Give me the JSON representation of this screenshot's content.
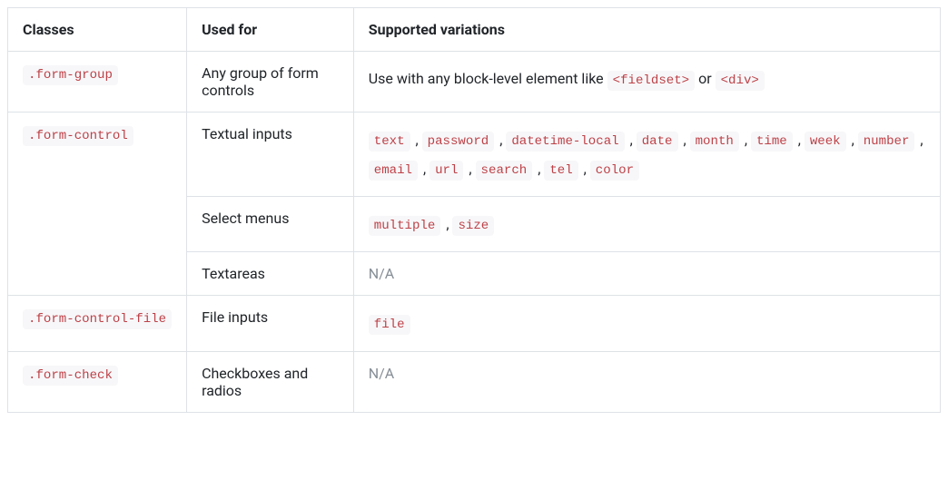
{
  "headers": {
    "col0": "Classes",
    "col1": "Used for",
    "col2": "Supported variations"
  },
  "rows": {
    "r0": {
      "class_code": ".form-group",
      "used_for": "Any group of form controls",
      "variations_prefix": "Use with any block-level element like ",
      "variations_codes": {
        "c0": "<fieldset>",
        "c1": "<div>"
      },
      "variations_sep": " or "
    },
    "r1": {
      "class_code": ".form-control",
      "used_for": "Textual inputs",
      "variations_codes": {
        "c0": "text",
        "c1": "password",
        "c2": "datetime-local",
        "c3": "date",
        "c4": "month",
        "c5": "time",
        "c6": "week",
        "c7": "number",
        "c8": "email",
        "c9": "url",
        "c10": "search",
        "c11": "tel",
        "c12": "color"
      }
    },
    "r2": {
      "used_for": "Select menus",
      "variations_codes": {
        "c0": "multiple",
        "c1": "size"
      }
    },
    "r3": {
      "used_for": "Textareas",
      "na": "N/A"
    },
    "r4": {
      "class_code": ".form-control-file",
      "used_for": "File inputs",
      "variations_codes": {
        "c0": "file"
      }
    },
    "r5": {
      "class_code": ".form-check",
      "used_for": "Checkboxes and radios",
      "na": "N/A"
    }
  },
  "sep": " , "
}
